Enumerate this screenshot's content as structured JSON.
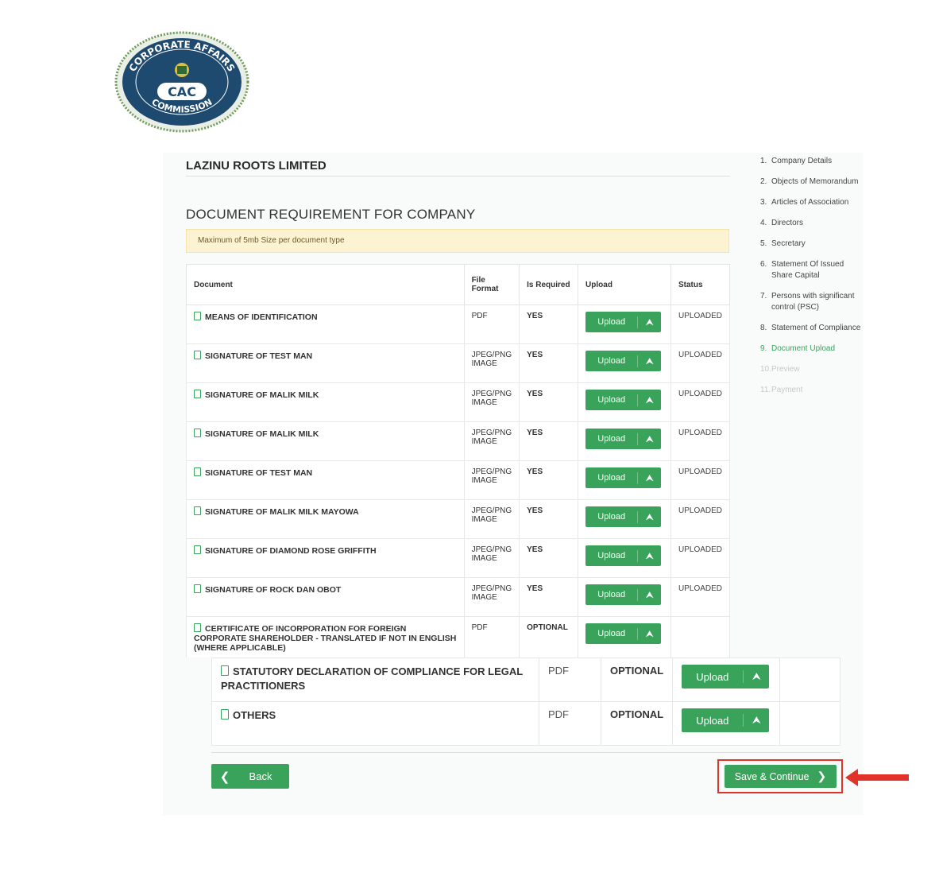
{
  "logo": {
    "text_top": "CORPORATE AFFAIRS",
    "text_bottom": "COMMISSION",
    "abbr": "CAC"
  },
  "company_name": "LAZINU ROOTS LIMITED",
  "page_title": "DOCUMENT REQUIREMENT FOR COMPANY",
  "alert_text": "Maximum of 5mb Size per document type",
  "table": {
    "headers": [
      "Document",
      "File Format",
      "Is Required",
      "Upload",
      "Status"
    ],
    "rows": [
      {
        "doc": "MEANS OF IDENTIFICATION",
        "format": "PDF",
        "required": "YES",
        "upload": "Upload",
        "status": "UPLOADED"
      },
      {
        "doc": "SIGNATURE OF TEST MAN",
        "format": "JPEG/PNG IMAGE",
        "required": "YES",
        "upload": "Upload",
        "status": "UPLOADED"
      },
      {
        "doc": "SIGNATURE OF MALIK MILK",
        "format": "JPEG/PNG IMAGE",
        "required": "YES",
        "upload": "Upload",
        "status": "UPLOADED"
      },
      {
        "doc": "SIGNATURE OF MALIK MILK",
        "format": "JPEG/PNG IMAGE",
        "required": "YES",
        "upload": "Upload",
        "status": "UPLOADED"
      },
      {
        "doc": "SIGNATURE OF TEST MAN",
        "format": "JPEG/PNG IMAGE",
        "required": "YES",
        "upload": "Upload",
        "status": "UPLOADED"
      },
      {
        "doc": "SIGNATURE OF MALIK MILK MAYOWA",
        "format": "JPEG/PNG IMAGE",
        "required": "YES",
        "upload": "Upload",
        "status": "UPLOADED"
      },
      {
        "doc": "SIGNATURE OF DIAMOND ROSE GRIFFITH",
        "format": "JPEG/PNG IMAGE",
        "required": "YES",
        "upload": "Upload",
        "status": "UPLOADED"
      },
      {
        "doc": "SIGNATURE OF ROCK DAN OBOT",
        "format": "JPEG/PNG IMAGE",
        "required": "YES",
        "upload": "Upload",
        "status": "UPLOADED"
      },
      {
        "doc": "CERTIFICATE OF INCORPORATION FOR FOREIGN CORPORATE SHAREHOLDER - TRANSLATED IF NOT IN ENGLISH (WHERE APPLICABLE)",
        "format": "PDF",
        "required": "OPTIONAL",
        "upload": "Upload",
        "status": ""
      }
    ],
    "lower_rows": [
      {
        "doc": "STATUTORY DECLARATION OF COMPLIANCE FOR LEGAL PRACTITIONERS",
        "format": "PDF",
        "required": "OPTIONAL",
        "upload": "Upload",
        "status": ""
      },
      {
        "doc": "OTHERS",
        "format": "PDF",
        "required": "OPTIONAL",
        "upload": "Upload",
        "status": ""
      }
    ]
  },
  "steps": [
    {
      "num": "1.",
      "label": "Company Details",
      "state": "done"
    },
    {
      "num": "2.",
      "label": "Objects of Memorandum",
      "state": "done"
    },
    {
      "num": "3.",
      "label": "Articles of Association",
      "state": "done"
    },
    {
      "num": "4.",
      "label": "Directors",
      "state": "done"
    },
    {
      "num": "5.",
      "label": "Secretary",
      "state": "done"
    },
    {
      "num": "6.",
      "label": "Statement Of Issued Share Capital",
      "state": "done"
    },
    {
      "num": "7.",
      "label": "Persons with significant control (PSC)",
      "state": "done"
    },
    {
      "num": "8.",
      "label": "Statement of Compliance",
      "state": "done"
    },
    {
      "num": "9.",
      "label": "Document Upload",
      "state": "active"
    },
    {
      "num": "10.",
      "label": "Preview",
      "state": "disabled"
    },
    {
      "num": "11.",
      "label": "Payment",
      "state": "disabled"
    }
  ],
  "buttons": {
    "back": "Back",
    "save_continue": "Save & Continue"
  },
  "colors": {
    "primary_green": "#3aa35b",
    "alert_bg": "#fcf3d2",
    "highlight_red": "#e0342a"
  },
  "icons": {
    "file": "file-icon",
    "upload": "upload-icon",
    "chevron_left": "chevron-left-icon",
    "chevron_right": "chevron-right-icon",
    "annotation_arrow": "red-arrow-icon"
  }
}
